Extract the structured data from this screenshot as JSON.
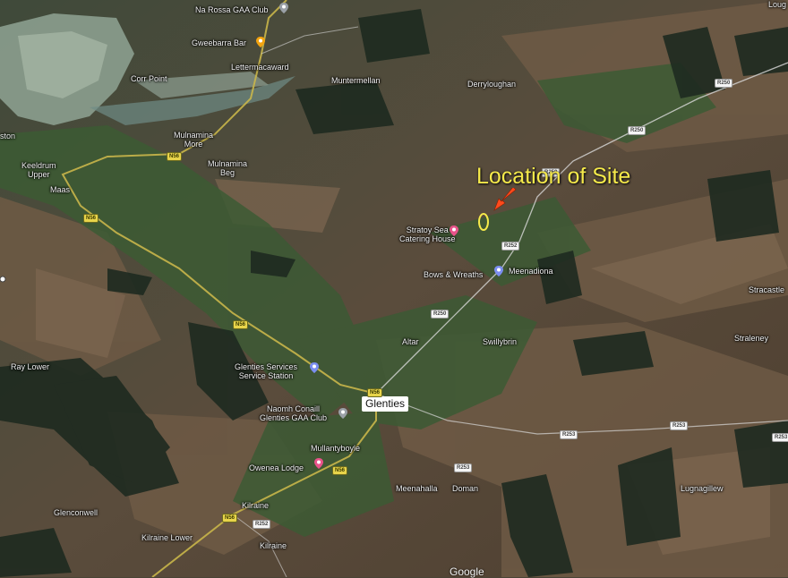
{
  "map": {
    "annotation": "Location of Site",
    "watermark": "Google",
    "town_label": "Glenties",
    "colors": {
      "annotation": "#f5e94a",
      "arrow": "#ff4a1c",
      "road": "#c9b64a"
    }
  },
  "places": {
    "na_rossa": "Na Rossa GAA Club",
    "gweebarra_bar": "Gweebarra Bar",
    "lettermacaward": "Lettermacaward",
    "corr_point": "Corr Point",
    "muntermellan": "Muntermellan",
    "derryloughan": "Derryloughan",
    "loug": "Loug",
    "ston": "ston",
    "mulnamina_more": "Mulnamina\nMore",
    "mulnamina_beg": "Mulnamina\nBeg",
    "keeldrum": "Keeldrum\nUpper",
    "maas": "Maas",
    "stratoy": "Stratoy Sea\nCatering House",
    "bows": "Bows & Wreaths",
    "meenadiona": "Meenadiona",
    "stracastle": "Stracastle",
    "straleney": "Straleney",
    "ray_lower": "Ray Lower",
    "glenties_services": "Glenties Services\nService Station",
    "altar": "Altar",
    "swillybrin": "Swillybrin",
    "naomh_conaill": "Naomh Conaill\nGlenties GAA Club",
    "mullantyboyle": "Mullantyboyle",
    "owenea_lodge": "Owenea Lodge",
    "kilraine": "Kilraine",
    "kilraine_lower": "Kilraine Lower",
    "glenconwell": "Glenconwell",
    "meenahalla": "Meenahalla",
    "doman": "Doman",
    "lugnagillew": "Lugnagillew"
  },
  "roads": {
    "n56": "N56",
    "r250": "R250",
    "r252": "R252",
    "r253": "R253",
    "r254": "R254"
  }
}
